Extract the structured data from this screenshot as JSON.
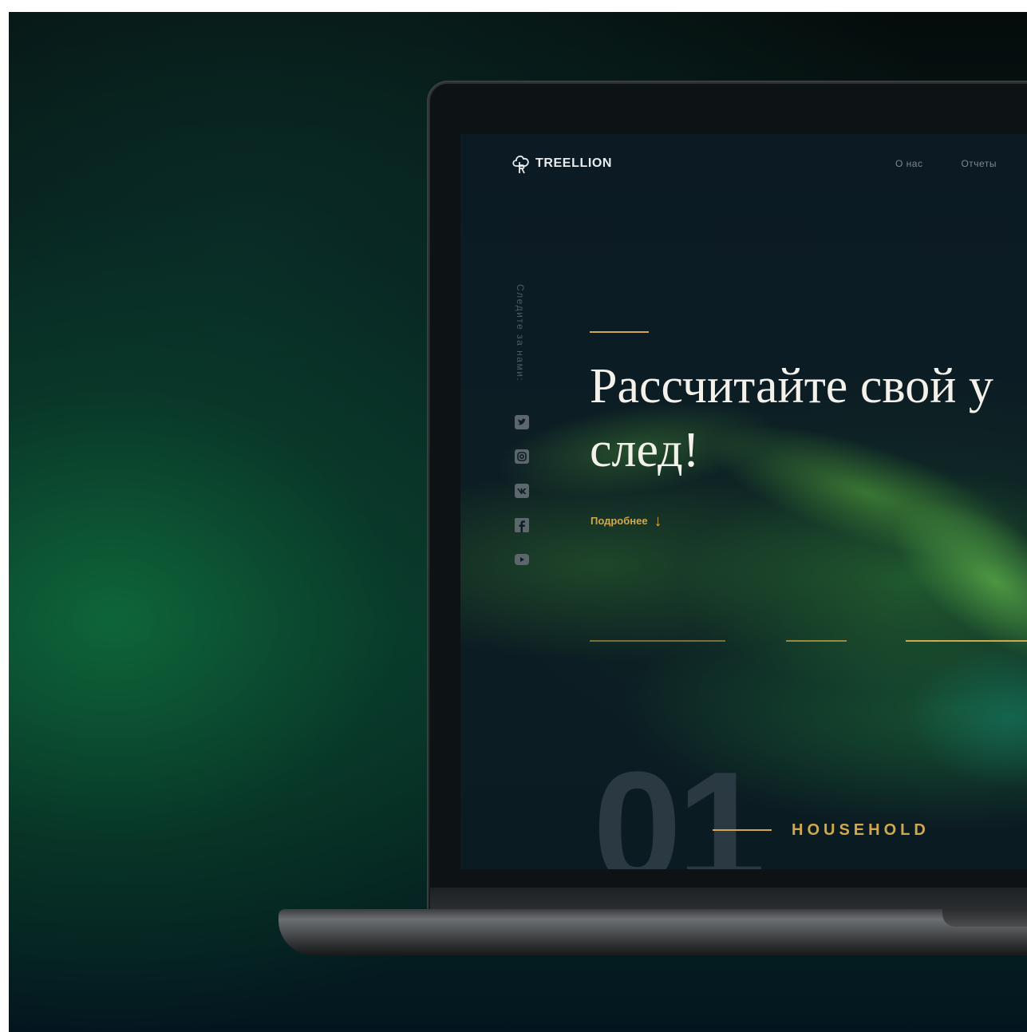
{
  "brand": {
    "name": "TREELLION",
    "logo_icon": "tree-logo-icon"
  },
  "nav": {
    "items": [
      "О нас",
      "Отчеты"
    ]
  },
  "sidebar": {
    "follow_label": "Следите за нами:",
    "social": [
      {
        "name": "twitter-icon"
      },
      {
        "name": "instagram-icon"
      },
      {
        "name": "vk-icon"
      },
      {
        "name": "facebook-icon"
      },
      {
        "name": "youtube-icon"
      }
    ]
  },
  "hero": {
    "title": "Рассчитайте свой у\nслед!",
    "more_label": "Подробнее",
    "more_icon": "arrow-down-icon"
  },
  "section": {
    "number": "01",
    "category": "HOUSEHOLD"
  },
  "colors": {
    "accent": "#d2a84c",
    "screen_bg": "#0b1b22",
    "text_light": "#f4f1ea"
  }
}
